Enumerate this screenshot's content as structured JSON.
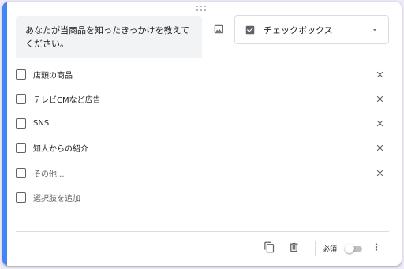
{
  "question": {
    "title": "あなたが当商品を知ったきっかけを教えてください。"
  },
  "type_selector": {
    "selected": "チェックボックス",
    "icon": "checkbox-checked-icon"
  },
  "options": [
    {
      "label": "店頭の商品"
    },
    {
      "label": "テレビCMなど広告"
    },
    {
      "label": "SNS"
    },
    {
      "label": "知人からの紹介"
    },
    {
      "label": "その他..."
    }
  ],
  "add_option_label": "選択肢を追加",
  "footer": {
    "required_label": "必須",
    "required": false
  },
  "colors": {
    "accent": "#4285f4",
    "background": "#f0ebf8",
    "icon": "#5f6368"
  }
}
